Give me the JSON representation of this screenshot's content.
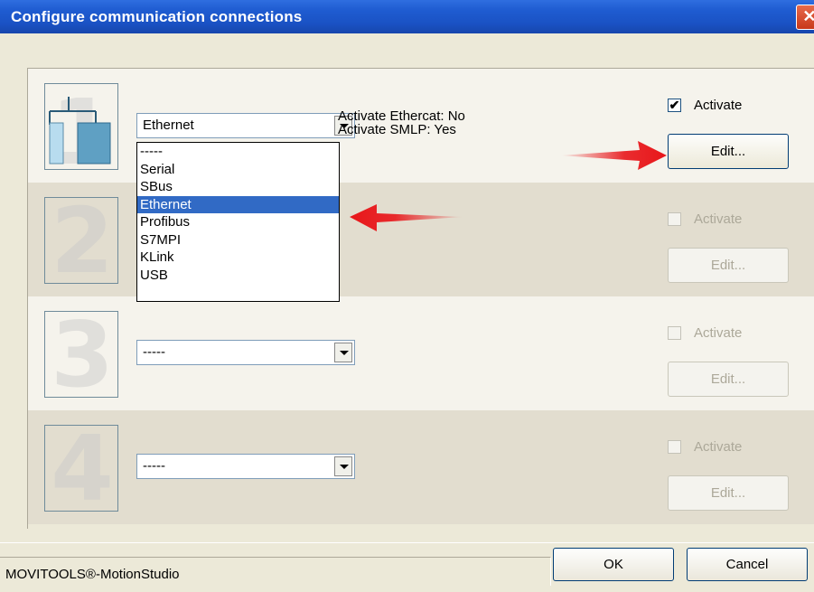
{
  "window": {
    "title": "Configure communication connections",
    "close_glyph": "✕"
  },
  "connections": [
    {
      "number": "1",
      "selected": "Ethernet",
      "info": [
        "Activate Ethercat: No",
        "Activate SMLP: Yes"
      ],
      "activate_label": "Activate",
      "activate_checked": true,
      "edit_label": "Edit..."
    },
    {
      "number": "2",
      "selected": "",
      "activate_label": "Activate",
      "activate_checked": false,
      "edit_label": "Edit..."
    },
    {
      "number": "3",
      "selected": "-----",
      "activate_label": "Activate",
      "activate_checked": false,
      "edit_label": "Edit..."
    },
    {
      "number": "4",
      "selected": "-----",
      "activate_label": "Activate",
      "activate_checked": false,
      "edit_label": "Edit..."
    }
  ],
  "dropdown_options": [
    "-----",
    "Serial",
    "SBus",
    "Ethernet",
    "Profibus",
    "S7MPI",
    "KLink",
    "USB"
  ],
  "dropdown_selected_index": 3,
  "footer": {
    "status": "MOVITOOLS®-MotionStudio",
    "ok_label": "OK",
    "cancel_label": "Cancel"
  },
  "colors": {
    "title_blue": "#1f5cd1",
    "selection_blue": "#316ac5",
    "arrow_red": "#e8161a"
  },
  "icons": [
    "network-tree-icon",
    "number-2-icon",
    "number-3-icon",
    "number-4-icon",
    "red-arrow-icon"
  ]
}
